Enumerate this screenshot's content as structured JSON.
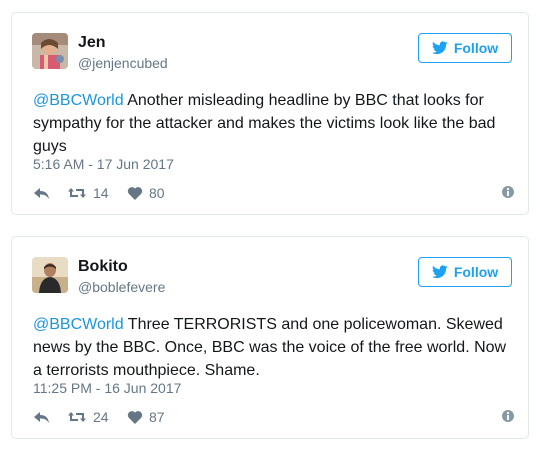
{
  "tweets": [
    {
      "author": {
        "name": "Jen",
        "handle": "@jenjencubed"
      },
      "follow_label": "Follow",
      "mention": "@BBCWorld",
      "text": " Another misleading headline by BBC that looks for sympathy for the attacker and makes the victims look like the bad guys",
      "timestamp": "5:16 AM - 17 Jun 2017",
      "retweets": "14",
      "likes": "80"
    },
    {
      "author": {
        "name": "Bokito",
        "handle": "@boblefevere"
      },
      "follow_label": "Follow",
      "mention": "@BBCWorld",
      "text": " Three TERRORISTS and one policewoman. Skewed news by the BBC. Once, BBC was the voice of the free world. Now a terrorists mouthpiece. Shame.",
      "timestamp": "11:25 PM - 16 Jun 2017",
      "retweets": "24",
      "likes": "87"
    }
  ],
  "colors": {
    "accent": "#1da1f2",
    "mention": "#1b95e0",
    "muted": "#657786",
    "text": "#14171a",
    "border": "#e1e8ed"
  },
  "icons": [
    "twitter-bird-icon",
    "reply-icon",
    "retweet-icon",
    "heart-icon",
    "info-icon"
  ]
}
